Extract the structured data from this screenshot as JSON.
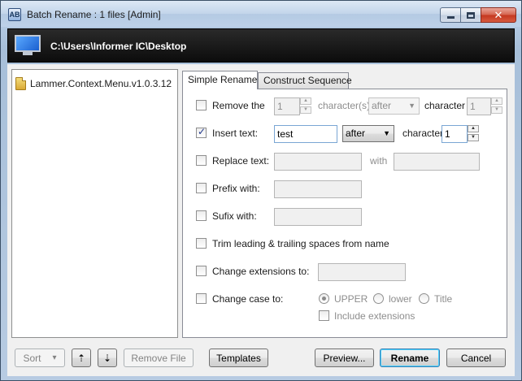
{
  "window": {
    "title": "Batch Rename : 1 files [Admin]",
    "app_icon_glyph": "AB",
    "minimize_icon": "minimize-icon",
    "maximize_icon": "maximize-icon",
    "close_glyph": "✕"
  },
  "path": {
    "value": "C:\\Users\\Informer IC\\Desktop",
    "icon": "monitor-icon"
  },
  "files": [
    {
      "name": "Lammer.Context.Menu.v1.0.3.12",
      "icon": "file-icon"
    }
  ],
  "tabs": [
    {
      "label": "Simple Rename",
      "active": true
    },
    {
      "label": "Construct Sequence",
      "active": false
    }
  ],
  "options": {
    "remove": {
      "label": "Remove the",
      "checked": false,
      "count": "1",
      "unit": "character(s)",
      "position": "after",
      "char_label": "character",
      "char_index": "1"
    },
    "insert": {
      "label": "Insert text:",
      "checked": true,
      "text": "test",
      "position": "after",
      "char_label": "character",
      "char_index": "1"
    },
    "replace": {
      "label": "Replace text:",
      "checked": false,
      "from": "",
      "with_label": "with",
      "to": ""
    },
    "prefix": {
      "label": "Prefix with:",
      "checked": false,
      "value": ""
    },
    "suffix": {
      "label": "Sufix with:",
      "checked": false,
      "value": ""
    },
    "trim": {
      "label": "Trim leading & trailing spaces from name",
      "checked": false
    },
    "extension": {
      "label": "Change extensions to:",
      "checked": false,
      "value": ""
    },
    "case": {
      "label": "Change case to:",
      "checked": false,
      "choices": [
        {
          "label": "UPPER",
          "selected": true
        },
        {
          "label": "lower",
          "selected": false
        },
        {
          "label": "Title",
          "selected": false
        }
      ],
      "include_ext_label": "Include extensions",
      "include_ext_checked": false
    }
  },
  "bottom": {
    "sort_label": "Sort",
    "sort_arrow": "▾",
    "move_up_glyph": "⇡",
    "move_down_glyph": "⇣",
    "remove_file_label": "Remove File",
    "templates_label": "Templates",
    "preview_label": "Preview...",
    "rename_label": "Rename",
    "cancel_label": "Cancel"
  }
}
